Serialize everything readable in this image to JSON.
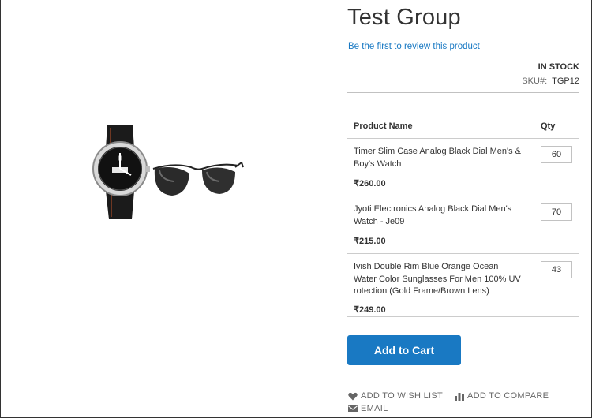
{
  "product": {
    "title": "Test Group",
    "review_link": "Be the first to review this product",
    "stock": "IN STOCK",
    "sku_label": "SKU#:",
    "sku_value": "TGP12"
  },
  "grouped_table": {
    "col_name": "Product Name",
    "col_qty": "Qty",
    "rows": [
      {
        "name": "Timer Slim Case Analog Black Dial Men's & Boy's Watch",
        "price": "₹260.00",
        "qty": "60"
      },
      {
        "name": "Jyoti Electronics Analog Black Dial Men's Watch - Je09",
        "price": "₹215.00",
        "qty": "70"
      },
      {
        "name": "Ivish Double Rim Blue Orange Ocean Water Color Sunglasses For Men 100% UV rotection (Gold Frame/Brown Lens)",
        "price": "₹249.00",
        "qty": "43"
      }
    ]
  },
  "actions": {
    "add_to_cart": "Add to Cart",
    "wishlist": "ADD TO WISH LIST",
    "compare": "ADD TO COMPARE",
    "email": "EMAIL"
  },
  "icons": {
    "wishlist": "heart-icon",
    "compare": "bar-chart-icon",
    "email": "envelope-icon"
  },
  "colors": {
    "accent": "#1979c3",
    "text": "#333333"
  }
}
